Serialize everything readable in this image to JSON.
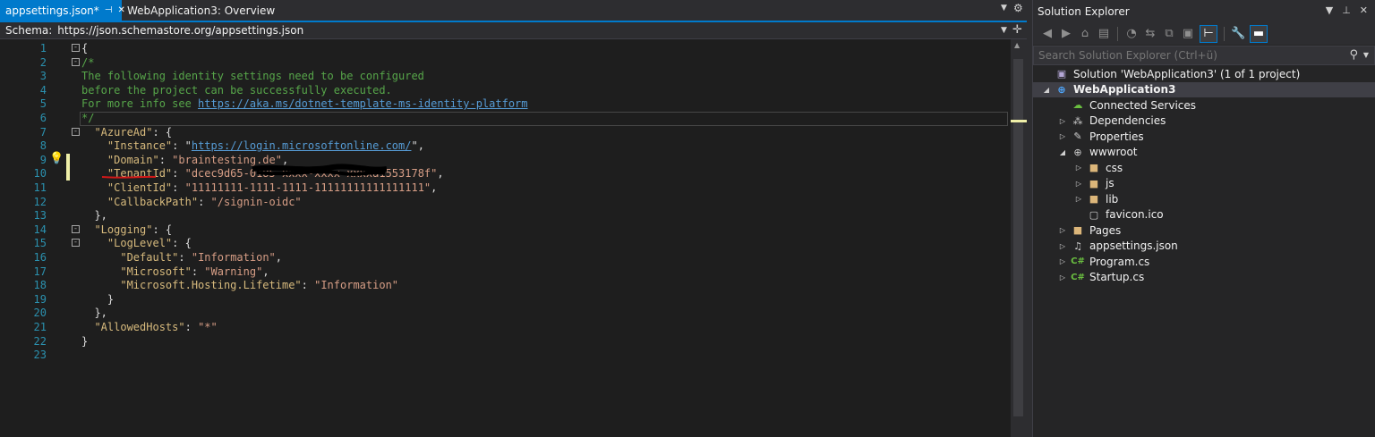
{
  "tabs": [
    {
      "label": "appsettings.json*",
      "icons": [
        "pin-icon",
        "close-icon"
      ],
      "active": true
    },
    {
      "label": "WebApplication3: Overview",
      "active": false
    }
  ],
  "schema": {
    "label": "Schema:",
    "value": "https://json.schemastore.org/appsettings.json"
  },
  "code_lines": [
    {
      "n": "1",
      "fold": "-",
      "segments": [
        {
          "t": "{",
          "c": "punc"
        }
      ]
    },
    {
      "n": "2",
      "fold": "-",
      "segments": [
        {
          "t": "/*",
          "c": "comment"
        }
      ]
    },
    {
      "n": "3",
      "segments": [
        {
          "t": "The following identity settings need to be configured",
          "c": "comment"
        }
      ]
    },
    {
      "n": "4",
      "segments": [
        {
          "t": "before the project can be successfully executed.",
          "c": "comment"
        }
      ]
    },
    {
      "n": "5",
      "segments": [
        {
          "t": "For more info see ",
          "c": "comment"
        },
        {
          "t": "https://aka.ms/dotnet-template-ms-identity-platform",
          "c": "link"
        }
      ]
    },
    {
      "n": "6",
      "segments": [
        {
          "t": "*/",
          "c": "comment"
        }
      ]
    },
    {
      "n": "7",
      "fold": "-",
      "segments": [
        {
          "t": "  ",
          "c": "punc"
        },
        {
          "t": "\"AzureAd\"",
          "c": "key"
        },
        {
          "t": ": {",
          "c": "punc"
        }
      ]
    },
    {
      "n": "8",
      "segments": [
        {
          "t": "    ",
          "c": "punc"
        },
        {
          "t": "\"Instance\"",
          "c": "key"
        },
        {
          "t": ": \"",
          "c": "punc"
        },
        {
          "t": "https://login.microsoftonline.com/",
          "c": "strlink"
        },
        {
          "t": "\",",
          "c": "punc"
        }
      ]
    },
    {
      "n": "9",
      "mark": true,
      "segments": [
        {
          "t": "    ",
          "c": "punc"
        },
        {
          "t": "\"Domain\"",
          "c": "key"
        },
        {
          "t": ": ",
          "c": "punc"
        },
        {
          "t": "\"braintesting.de\"",
          "c": "str"
        },
        {
          "t": ",",
          "c": "punc"
        }
      ]
    },
    {
      "n": "10",
      "mark": true,
      "segments": [
        {
          "t": "    ",
          "c": "punc"
        },
        {
          "t": "\"TenantId\"",
          "c": "key"
        },
        {
          "t": ": ",
          "c": "punc"
        },
        {
          "t": "\"dcec9d65-0185-xxxx-xxxx-xxxxa1553178f\"",
          "c": "str"
        },
        {
          "t": ",",
          "c": "punc"
        }
      ]
    },
    {
      "n": "11",
      "segments": [
        {
          "t": "    ",
          "c": "punc"
        },
        {
          "t": "\"ClientId\"",
          "c": "key"
        },
        {
          "t": ": ",
          "c": "punc"
        },
        {
          "t": "\"11111111-1111-1111-11111111111111111\"",
          "c": "str"
        },
        {
          "t": ",",
          "c": "punc"
        }
      ]
    },
    {
      "n": "12",
      "segments": [
        {
          "t": "    ",
          "c": "punc"
        },
        {
          "t": "\"CallbackPath\"",
          "c": "key"
        },
        {
          "t": ": ",
          "c": "punc"
        },
        {
          "t": "\"/signin-oidc\"",
          "c": "str"
        }
      ]
    },
    {
      "n": "13",
      "segments": [
        {
          "t": "  },",
          "c": "punc"
        }
      ]
    },
    {
      "n": "14",
      "fold": "-",
      "segments": [
        {
          "t": "  ",
          "c": "punc"
        },
        {
          "t": "\"Logging\"",
          "c": "key"
        },
        {
          "t": ": {",
          "c": "punc"
        }
      ]
    },
    {
      "n": "15",
      "fold": "-",
      "segments": [
        {
          "t": "    ",
          "c": "punc"
        },
        {
          "t": "\"LogLevel\"",
          "c": "key"
        },
        {
          "t": ": {",
          "c": "punc"
        }
      ]
    },
    {
      "n": "16",
      "segments": [
        {
          "t": "      ",
          "c": "punc"
        },
        {
          "t": "\"Default\"",
          "c": "key"
        },
        {
          "t": ": ",
          "c": "punc"
        },
        {
          "t": "\"Information\"",
          "c": "str"
        },
        {
          "t": ",",
          "c": "punc"
        }
      ]
    },
    {
      "n": "17",
      "segments": [
        {
          "t": "      ",
          "c": "punc"
        },
        {
          "t": "\"Microsoft\"",
          "c": "key"
        },
        {
          "t": ": ",
          "c": "punc"
        },
        {
          "t": "\"Warning\"",
          "c": "str"
        },
        {
          "t": ",",
          "c": "punc"
        }
      ]
    },
    {
      "n": "18",
      "segments": [
        {
          "t": "      ",
          "c": "punc"
        },
        {
          "t": "\"Microsoft.Hosting.Lifetime\"",
          "c": "key"
        },
        {
          "t": ": ",
          "c": "punc"
        },
        {
          "t": "\"Information\"",
          "c": "str"
        }
      ]
    },
    {
      "n": "19",
      "segments": [
        {
          "t": "    }",
          "c": "punc"
        }
      ]
    },
    {
      "n": "20",
      "segments": [
        {
          "t": "  },",
          "c": "punc"
        }
      ]
    },
    {
      "n": "21",
      "segments": [
        {
          "t": "  ",
          "c": "punc"
        },
        {
          "t": "\"AllowedHosts\"",
          "c": "key"
        },
        {
          "t": ": ",
          "c": "punc"
        },
        {
          "t": "\"*\"",
          "c": "str"
        }
      ]
    },
    {
      "n": "22",
      "segments": [
        {
          "t": "}",
          "c": "punc"
        }
      ]
    },
    {
      "n": "23",
      "segments": []
    }
  ],
  "solution_explorer": {
    "title": "Solution Explorer",
    "search_placeholder": "Search Solution Explorer (Ctrl+ü)",
    "tree": [
      {
        "label": "Solution 'WebApplication3' (1 of 1 project)",
        "level": 0,
        "arrow": "",
        "icon": "solution-icon",
        "glyph": "▣",
        "cls": "ic-sol"
      },
      {
        "label": "WebApplication3",
        "level": 0,
        "arrow": "◢",
        "icon": "web-project-icon",
        "glyph": "⊕",
        "cls": "ic-proj",
        "selected": true
      },
      {
        "label": "Connected Services",
        "level": 1,
        "arrow": "",
        "icon": "connected-services-icon",
        "glyph": "☁",
        "cls": "ic-conn"
      },
      {
        "label": "Dependencies",
        "level": 1,
        "arrow": "▷",
        "icon": "dependencies-icon",
        "glyph": "⁂",
        "cls": "ic-dep"
      },
      {
        "label": "Properties",
        "level": 1,
        "arrow": "▷",
        "icon": "properties-wrench-icon",
        "glyph": "✎",
        "cls": "ic-wrench"
      },
      {
        "label": "wwwroot",
        "level": 1,
        "arrow": "◢",
        "icon": "globe-icon",
        "glyph": "⊕",
        "cls": "ic-globe"
      },
      {
        "label": "css",
        "level": 2,
        "arrow": "▷",
        "icon": "folder-icon",
        "glyph": "■",
        "cls": "ic-folder"
      },
      {
        "label": "js",
        "level": 2,
        "arrow": "▷",
        "icon": "folder-icon",
        "glyph": "■",
        "cls": "ic-folder"
      },
      {
        "label": "lib",
        "level": 2,
        "arrow": "▷",
        "icon": "folder-icon",
        "glyph": "■",
        "cls": "ic-folder"
      },
      {
        "label": "favicon.ico",
        "level": 2,
        "arrow": "",
        "icon": "image-file-icon",
        "glyph": "▢",
        "cls": "ic-file"
      },
      {
        "label": "Pages",
        "level": 1,
        "arrow": "▷",
        "icon": "folder-icon",
        "glyph": "■",
        "cls": "ic-folder"
      },
      {
        "label": "appsettings.json",
        "level": 1,
        "arrow": "▷",
        "icon": "json-file-icon",
        "glyph": "♫",
        "cls": "ic-file"
      },
      {
        "label": "Program.cs",
        "level": 1,
        "arrow": "▷",
        "icon": "csharp-file-icon",
        "glyph": "C#",
        "cls": "ic-cs"
      },
      {
        "label": "Startup.cs",
        "level": 1,
        "arrow": "▷",
        "icon": "csharp-file-icon",
        "glyph": "C#",
        "cls": "ic-cs"
      }
    ]
  },
  "colors": {
    "accent": "#007acc",
    "comment": "#57a64a",
    "key": "#d7ba7d",
    "string": "#d69d85",
    "link": "#569cd6",
    "line_number": "#2b91af",
    "change_mark": "#efefa8"
  }
}
